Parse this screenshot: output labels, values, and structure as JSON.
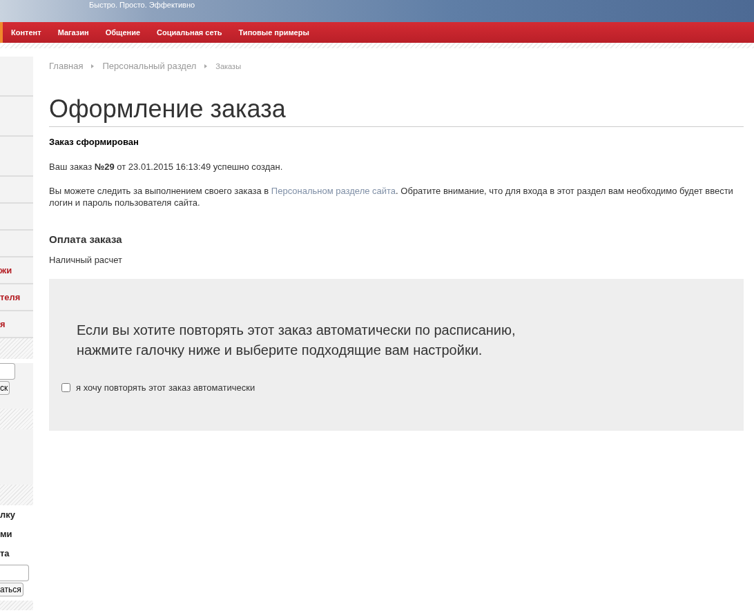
{
  "header": {
    "slogan": "Быстро. Просто. Эффективно"
  },
  "menu": [
    {
      "label": "Контент"
    },
    {
      "label": "Магазин"
    },
    {
      "label": "Общение"
    },
    {
      "label": "Социальная сеть"
    },
    {
      "label": "Типовые примеры"
    }
  ],
  "sidebar": {
    "links": [
      "жи",
      "теля",
      "я"
    ],
    "search_button": "ск",
    "auth_texts": [
      "лку",
      "ми",
      "та"
    ],
    "auth_button": "аться"
  },
  "breadcrumb": [
    "Главная",
    "Персональный раздел",
    "Заказы"
  ],
  "title": "Оформление заказа",
  "status": "Заказ сформирован",
  "order_line": "Ваш заказ **№29** от 23.01.2015 16:13:49 успешно создан.",
  "notice": {
    "before": "Вы можете следить за выполнением своего заказа в",
    "link": "Персональном разделе сайта",
    "after": ". Обратите внимание, что для входа в этот раздел вам необходимо будет ввести логин и пароль пользователя сайта."
  },
  "payment": {
    "heading": "Оплата заказа",
    "method": "Наличный расчет"
  },
  "repeat": {
    "text": "Если вы хотите повторять этот заказ автоматически по расписанию, нажмите галочку ниже и выберите подходящие вам настройки.",
    "checkbox_label": "я хочу повторять этот заказ автоматически",
    "checked": false
  }
}
